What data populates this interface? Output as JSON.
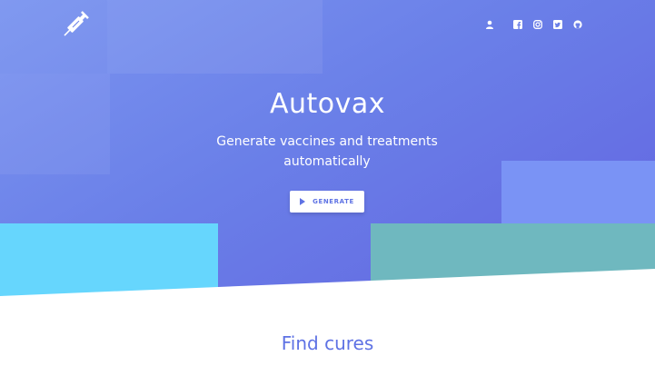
{
  "brand": {
    "logo_icon": "syringe-icon"
  },
  "nav": {
    "icons": [
      "user-icon",
      "facebook-icon",
      "instagram-icon",
      "twitter-icon",
      "github-icon"
    ]
  },
  "hero": {
    "title": "Autovax",
    "subtitle": "Generate vaccines and treatments automatically",
    "button_label": "GENERATE",
    "button_icon": "play-icon"
  },
  "section": {
    "title": "Find cures"
  },
  "colors": {
    "accent": "#5e72e4",
    "hero_gradient_start": "#7b95f0",
    "hero_gradient_end": "#6263e0",
    "cyan_block": "#66d6fd",
    "teal_block": "#6fb8bf"
  }
}
